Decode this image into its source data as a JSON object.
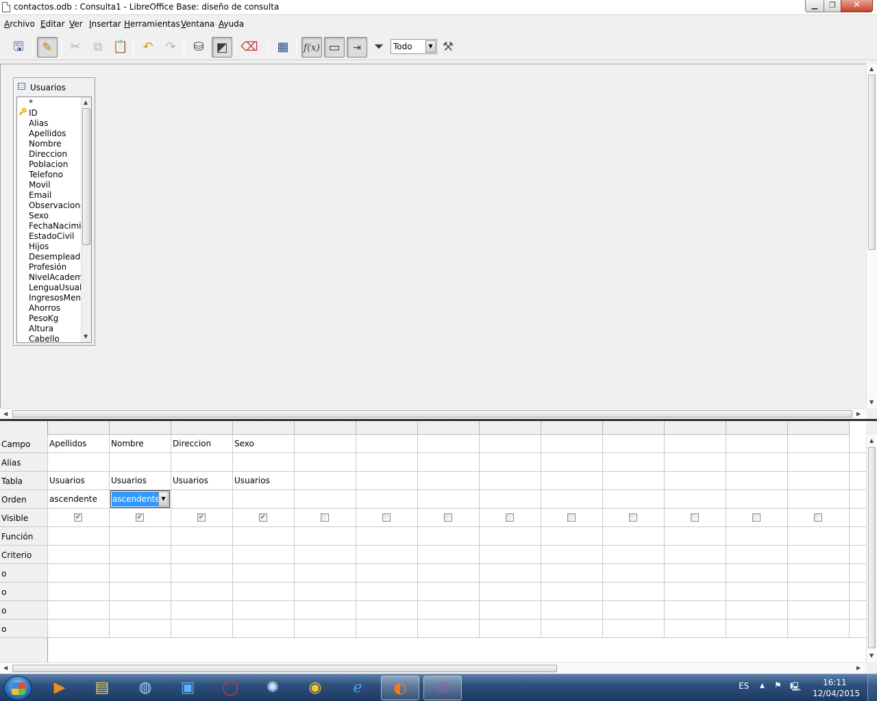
{
  "window": {
    "title": "contactos.odb : Consulta1 - LibreOffice Base: diseño de consulta",
    "minimize_label": "▁",
    "maximize_label": "❐",
    "close_label": "✕"
  },
  "menu": [
    "Archivo",
    "Editar",
    "Ver",
    "Insertar",
    "Herramientas",
    "Ventana",
    "Ayuda"
  ],
  "toolbar": {
    "filter_value": "Todo",
    "icons": [
      "save-icon",
      "edit-mode-icon",
      "cut-icon",
      "copy-icon",
      "paste-icon",
      "undo-icon",
      "redo-icon",
      "run-query-icon",
      "design-view-icon",
      "clear-query-icon",
      "add-table-icon",
      "functions-icon",
      "table-name-icon",
      "alias-icon",
      "distinct-values-icon",
      "limit-icon",
      "sql-native-icon"
    ]
  },
  "table_window": {
    "title": "Usuarios",
    "fields": [
      "*",
      "ID",
      "Alias",
      "Apellidos",
      "Nombre",
      "Direccion",
      "Poblacion",
      "Telefono",
      "Movil",
      "Email",
      "Observaciones",
      "Sexo",
      "FechaNacimiento",
      "EstadoCivil",
      "Hijos",
      "Desempleado",
      "Profesión",
      "NivelAcademico",
      "LenguaUsual",
      "IngresosMensuales",
      "Ahorros",
      "PesoKg",
      "Altura",
      "Cabello"
    ],
    "primary_key": "ID"
  },
  "grid": {
    "row_labels": [
      "Campo",
      "Alias",
      "Tabla",
      "Orden",
      "Visible",
      "Función",
      "Criterio",
      "o",
      "o",
      "o",
      "o"
    ],
    "columns": [
      {
        "campo": "Apellidos",
        "tabla": "Usuarios",
        "orden": "ascendente",
        "visible": true
      },
      {
        "campo": "Nombre",
        "tabla": "Usuarios",
        "orden": "ascendente",
        "visible": true
      },
      {
        "campo": "Direccion",
        "tabla": "Usuarios",
        "orden": "",
        "visible": true
      },
      {
        "campo": "Sexo",
        "tabla": "Usuarios",
        "orden": "",
        "visible": true
      },
      {
        "campo": "",
        "tabla": "",
        "orden": "",
        "visible": false
      },
      {
        "campo": "",
        "tabla": "",
        "orden": "",
        "visible": false
      },
      {
        "campo": "",
        "tabla": "",
        "orden": "",
        "visible": false
      },
      {
        "campo": "",
        "tabla": "",
        "orden": "",
        "visible": false
      },
      {
        "campo": "",
        "tabla": "",
        "orden": "",
        "visible": false
      },
      {
        "campo": "",
        "tabla": "",
        "orden": "",
        "visible": false
      },
      {
        "campo": "",
        "tabla": "",
        "orden": "",
        "visible": false
      },
      {
        "campo": "",
        "tabla": "",
        "orden": "",
        "visible": false
      },
      {
        "campo": "",
        "tabla": "",
        "orden": "",
        "visible": false
      }
    ],
    "active_orden_value": "ascendente"
  },
  "taskbar": {
    "apps": [
      "media-player-icon",
      "file-explorer-icon",
      "google-earth-icon",
      "maxthon-icon",
      "opera-icon",
      "safari-icon",
      "chrome-icon",
      "internet-explorer-icon",
      "firefox-icon",
      "libreoffice-base-icon"
    ],
    "language": "ES",
    "time": "16:11",
    "date": "12/04/2015"
  },
  "colors": {
    "selection": "#3399ff",
    "taskbar": "#2c4f7c",
    "close_button": "#c7432a"
  }
}
